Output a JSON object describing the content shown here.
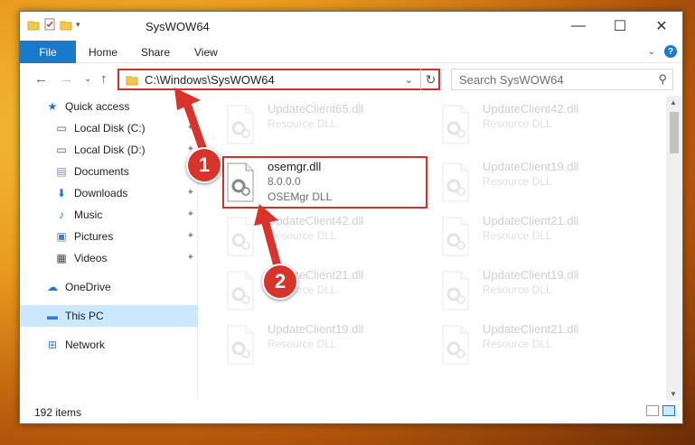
{
  "window": {
    "title": "SysWOW64"
  },
  "ribbon": {
    "file": "File",
    "home": "Home",
    "share": "Share",
    "view": "View",
    "help": "?"
  },
  "nav": {
    "path": "C:\\Windows\\SysWOW64",
    "search_placeholder": "Search SysWOW64"
  },
  "sidebar": {
    "items": [
      {
        "label": "Quick access",
        "icon": "star-icon",
        "pinned": false
      },
      {
        "label": "Local Disk (C:)",
        "icon": "drive-icon",
        "pinned": true
      },
      {
        "label": "Local Disk (D:)",
        "icon": "drive-icon",
        "pinned": true
      },
      {
        "label": "Documents",
        "icon": "documents-icon",
        "pinned": true
      },
      {
        "label": "Downloads",
        "icon": "download-icon",
        "pinned": true
      },
      {
        "label": "Music",
        "icon": "music-icon",
        "pinned": true
      },
      {
        "label": "Pictures",
        "icon": "pictures-icon",
        "pinned": true
      },
      {
        "label": "Videos",
        "icon": "videos-icon",
        "pinned": true
      },
      {
        "label": "OneDrive",
        "icon": "cloud-icon",
        "pinned": false
      },
      {
        "label": "This PC",
        "icon": "computer-icon",
        "pinned": false
      },
      {
        "label": "Network",
        "icon": "network-icon",
        "pinned": false
      }
    ]
  },
  "files": [
    {
      "name": "UpdateClient65.dll",
      "type": "Resource DLL"
    },
    {
      "name": "UpdateClient42.dll",
      "type": "Resource DLL"
    },
    {
      "name": "osemgr.dll",
      "version": "8.0.0.0",
      "type": "OSEMgr DLL"
    },
    {
      "name": "UpdateClient19.dll",
      "type": "Resource DLL"
    },
    {
      "name": "UpdateClient42.dll",
      "type": "Resource DLL"
    },
    {
      "name": "UpdateClient21.dll",
      "type": "Resource DLL"
    },
    {
      "name": "UpdateClient21.dll",
      "type": "Resource DLL"
    },
    {
      "name": "UpdateClient19.dll",
      "type": "Resource DLL"
    },
    {
      "name": "UpdateClient19.dll",
      "type": "Resource DLL"
    },
    {
      "name": "UpdateClient21.dll",
      "type": "Resource DLL"
    }
  ],
  "status": {
    "count": "192 items"
  },
  "callouts": {
    "one": "1",
    "two": "2"
  },
  "colors": {
    "accent": "#1979ca",
    "highlight": "#d32f2f",
    "callout": "#d9342b",
    "selection": "#cce8ff"
  }
}
